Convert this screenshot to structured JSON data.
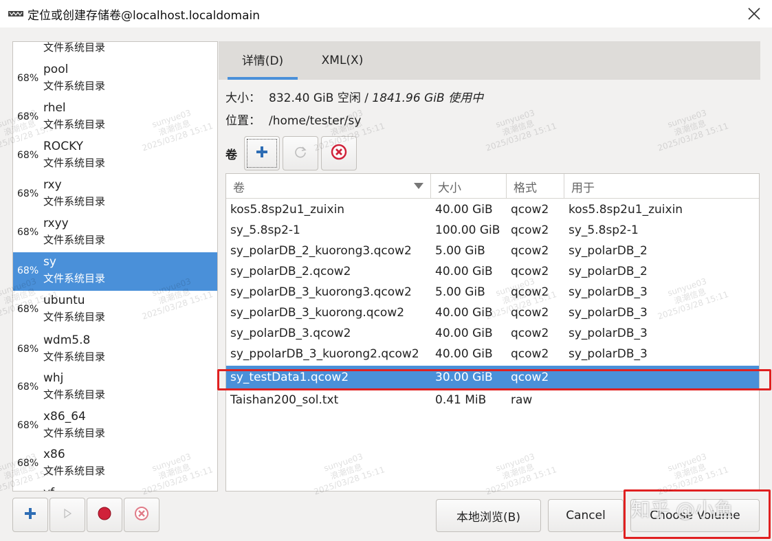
{
  "window": {
    "title": "定位或创建存储卷@localhost.localdomain",
    "close_icon": "close-icon",
    "app_icon": "virt-manager-icon"
  },
  "pools": [
    {
      "pct": "",
      "name": "",
      "type": "文件系统目录",
      "selected": false
    },
    {
      "pct": "68%",
      "name": "pool",
      "type": "文件系统目录",
      "selected": false
    },
    {
      "pct": "68%",
      "name": "rhel",
      "type": "文件系统目录",
      "selected": false
    },
    {
      "pct": "68%",
      "name": "ROCKY",
      "type": "文件系统目录",
      "selected": false
    },
    {
      "pct": "68%",
      "name": "rxy",
      "type": "文件系统目录",
      "selected": false
    },
    {
      "pct": "68%",
      "name": "rxyy",
      "type": "文件系统目录",
      "selected": false
    },
    {
      "pct": "68%",
      "name": "sy",
      "type": "文件系统目录",
      "selected": true
    },
    {
      "pct": "68%",
      "name": "ubuntu",
      "type": "文件系统目录",
      "selected": false
    },
    {
      "pct": "68%",
      "name": "wdm5.8",
      "type": "文件系统目录",
      "selected": false
    },
    {
      "pct": "68%",
      "name": "whj",
      "type": "文件系统目录",
      "selected": false
    },
    {
      "pct": "68%",
      "name": "x86_64",
      "type": "文件系统目录",
      "selected": false
    },
    {
      "pct": "68%",
      "name": "x86",
      "type": "文件系统目录",
      "selected": false
    },
    {
      "pct": "",
      "name": "yf",
      "type": "",
      "selected": false
    }
  ],
  "pool_toolbar": {
    "add_icon": "plus-icon",
    "start_icon": "play-icon",
    "stop_icon": "record-stop-icon",
    "delete_icon": "delete-circle-icon"
  },
  "tabs": [
    {
      "label": "详情(D)",
      "active": true
    },
    {
      "label": "XML(X)",
      "active": false
    }
  ],
  "details": {
    "size_label": "大小：",
    "size_free": "832.40 GiB 空闲 / ",
    "size_used": "1841.96 GiB 使用中",
    "location_label": "位置：",
    "location_value": "/home/tester/sy",
    "volumes_label": "卷"
  },
  "volume_table": {
    "headers": [
      "卷",
      "大小",
      "格式",
      "用于"
    ],
    "rows": [
      [
        "kos5.8sp2u1_zuixin",
        "40.00 GiB",
        "qcow2",
        "kos5.8sp2u1_zuixin"
      ],
      [
        "sy_5.8sp2-1",
        "100.00 GiB",
        "qcow2",
        "sy_5.8sp2-1"
      ],
      [
        "sy_polarDB_2_kuorong3.qcow2",
        "5.00 GiB",
        "qcow2",
        "sy_polarDB_2"
      ],
      [
        "sy_polarDB_2.qcow2",
        "40.00 GiB",
        "qcow2",
        "sy_polarDB_2"
      ],
      [
        "sy_polarDB_3_kuorong3.qcow2",
        "5.00 GiB",
        "qcow2",
        "sy_polarDB_3"
      ],
      [
        "sy_polarDB_3_kuorong.qcow2",
        "40.00 GiB",
        "qcow2",
        "sy_polarDB_3"
      ],
      [
        "sy_polarDB_3.qcow2",
        "40.00 GiB",
        "qcow2",
        "sy_polarDB_3"
      ],
      [
        "sy_ppolarDB_3_kuorong2.qcow2",
        "40.00 GiB",
        "qcow2",
        "sy_polarDB_3"
      ],
      [
        "sy_testData1.qcow2",
        "30.00 GiB",
        "qcow2",
        ""
      ],
      [
        "Taishan200_sol.txt",
        "0.41 MiB",
        "raw",
        ""
      ]
    ],
    "selected_row": 8
  },
  "buttons": {
    "browse_local": "本地浏览(B)",
    "cancel": "Cancel",
    "choose_volume": "Choose Volume"
  },
  "watermark": {
    "user": "sunyue03",
    "org": "浪潮信息",
    "datetime": "2025/03/28 15:11"
  },
  "overlay_text": "知乎 @小鱼",
  "colors": {
    "selection": "#4a90d9",
    "highlight_frame": "#e02020",
    "delete_red": "#d0223a"
  }
}
